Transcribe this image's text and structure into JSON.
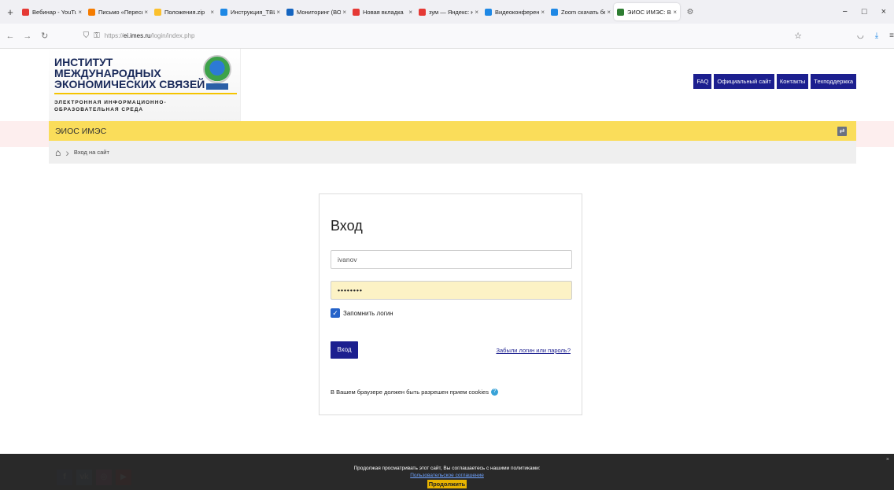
{
  "browser": {
    "tabs": [
      {
        "title": "Вебинар - YouTube",
        "color": "#e53935"
      },
      {
        "title": "Письмо «Пересылк...",
        "color": "#f57c00"
      },
      {
        "title": "Положения.zip",
        "color": "#fbc02d"
      },
      {
        "title": "Инструкция_ТВИ_V...",
        "color": "#1e88e5"
      },
      {
        "title": "Мониторинг (ВО)",
        "color": "#1565c0"
      },
      {
        "title": "Новая вкладка",
        "color": "#e53935"
      },
      {
        "title": "зум — Яндекс: наш...",
        "color": "#e53935"
      },
      {
        "title": "Видеоконференци...",
        "color": "#1e88e5"
      },
      {
        "title": "Zoom скачать беспл...",
        "color": "#1e88e5"
      },
      {
        "title": "ЭИОС ИМЭС: Вход",
        "color": "#2e7d32"
      }
    ],
    "tab_close": "×",
    "new_tab": "+",
    "url_scheme": "https://",
    "url_host": "ei.imes.ru",
    "url_path": "/login/index.php"
  },
  "site": {
    "logo_lines": [
      "ИНСТИТУТ",
      "МЕЖДУНАРОДНЫХ",
      "ЭКОНОМИЧЕСКИХ СВЯЗЕЙ"
    ],
    "logo_sub": [
      "ЭЛЕКТРОННАЯ ИНФОРМАЦИОННО-",
      "ОБРАЗОВАТЕЛЬНАЯ СРЕДА"
    ],
    "header_links": [
      "FAQ",
      "Официальный сайт",
      "Контакты",
      "Техподдержка"
    ],
    "brand": "ЭИОС ИМЭС",
    "breadcrumb": "Вход на сайт"
  },
  "login": {
    "title": "Вход",
    "username": "ivanov",
    "password_masked": "••••••••",
    "remember_label": "Запомнить логин",
    "remember_checked": true,
    "submit_label": "Вход",
    "forgot_link": "Забыли логин или пароль?",
    "cookies_note": "В Вашем браузере должен быть разрешен прием cookies"
  },
  "cookie_banner": {
    "text": "Продолжая просматривать этот сайт, Вы соглашаетесь с нашими политиками:",
    "link": "Пользовательское соглашение",
    "button": "Продолжить"
  },
  "colors": {
    "brand_blue": "#1c1f8f",
    "brand_yellow": "#fadd5a",
    "autofill": "#fcf2c5"
  }
}
